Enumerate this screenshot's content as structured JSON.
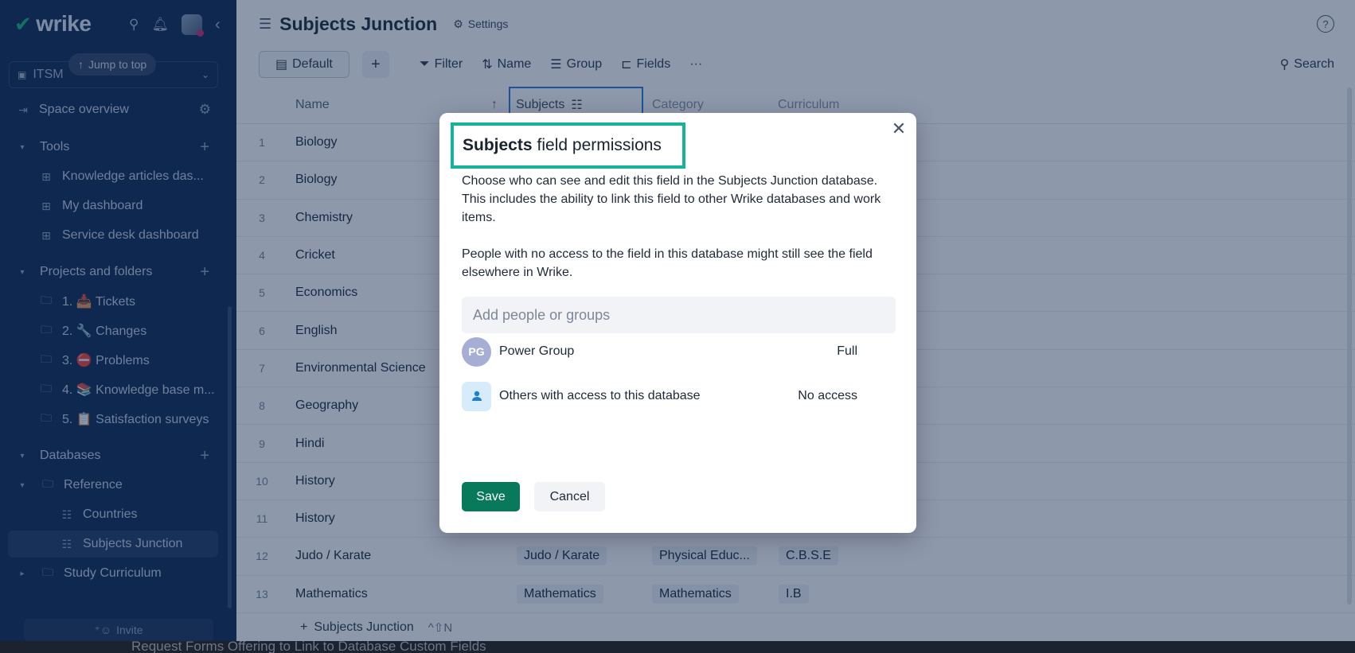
{
  "sidebar": {
    "brand": "wrike",
    "jump_to_top": "Jump to top",
    "space_name": "ITSM",
    "space_overview": "Space overview",
    "tools_header": "Tools",
    "tools": [
      "Knowledge articles das...",
      "My dashboard",
      "Service desk dashboard"
    ],
    "projects_header": "Projects and folders",
    "projects": [
      "1. 📥 Tickets",
      "2. 🔧 Changes",
      "3. ⛔ Problems",
      "4. 📚 Knowledge base m...",
      "5. 📋 Satisfaction surveys"
    ],
    "databases_header": "Databases",
    "reference_folder": "Reference",
    "reference_items": [
      "Countries",
      "Subjects Junction"
    ],
    "study_folder": "Study Curriculum",
    "invite": "Invite"
  },
  "header": {
    "title": "Subjects Junction",
    "settings": "Settings",
    "help": "?"
  },
  "toolbar": {
    "default_view": "Default",
    "add": "+",
    "filter": "Filter",
    "name": "Name",
    "group": "Group",
    "fields": "Fields",
    "more": "···",
    "search": "Search"
  },
  "table": {
    "columns": {
      "name": "Name",
      "subjects": "Subjects",
      "category": "Category",
      "curriculum": "Curriculum"
    },
    "rows": [
      {
        "num": "1",
        "name": "Biology",
        "subject": "",
        "category": "",
        "curriculum": ""
      },
      {
        "num": "2",
        "name": "Biology",
        "subject": "",
        "category": "",
        "curriculum": ""
      },
      {
        "num": "3",
        "name": "Chemistry",
        "subject": "",
        "category": "",
        "curriculum": ""
      },
      {
        "num": "4",
        "name": "Cricket",
        "subject": "",
        "category": "",
        "curriculum": ""
      },
      {
        "num": "5",
        "name": "Economics",
        "subject": "",
        "category": "",
        "curriculum": ""
      },
      {
        "num": "6",
        "name": "English",
        "subject": "",
        "category": "",
        "curriculum": ""
      },
      {
        "num": "7",
        "name": "Environmental Science",
        "subject": "",
        "category": "",
        "curriculum": ""
      },
      {
        "num": "8",
        "name": "Geography",
        "subject": "",
        "category": "",
        "curriculum": ""
      },
      {
        "num": "9",
        "name": "Hindi",
        "subject": "",
        "category": "",
        "curriculum": ""
      },
      {
        "num": "10",
        "name": "History",
        "subject": "",
        "category": "",
        "curriculum": ""
      },
      {
        "num": "11",
        "name": "History",
        "subject": "",
        "category": "",
        "curriculum": ""
      },
      {
        "num": "12",
        "name": "Judo / Karate",
        "subject": "Judo / Karate",
        "category": "Physical Educ...",
        "curriculum": "C.B.S.E"
      },
      {
        "num": "13",
        "name": "Mathematics",
        "subject": "Mathematics",
        "category": "Mathematics",
        "curriculum": "I.B"
      }
    ],
    "add_row_label": "Subjects Junction",
    "add_row_shortcut": "^⇧N"
  },
  "modal": {
    "title_bold": "Subjects",
    "title_rest": "field permissions",
    "desc_1": "Choose who can see and edit this field in the Subjects Junction database. This includes the ability to link this field to other Wrike databases and work items.",
    "desc_2": "People with no access to the field in this database might still see the field elsewhere in Wrike.",
    "input_placeholder": "Add people or groups",
    "permissions": [
      {
        "initials": "PG",
        "name": "Power Group",
        "level": "Full"
      },
      {
        "initials": "",
        "name": "Others with access to this database",
        "level": "No access"
      }
    ],
    "save": "Save",
    "cancel": "Cancel"
  },
  "background_strip_text": "Request Forms Offering to Link to Database Custom Fields"
}
